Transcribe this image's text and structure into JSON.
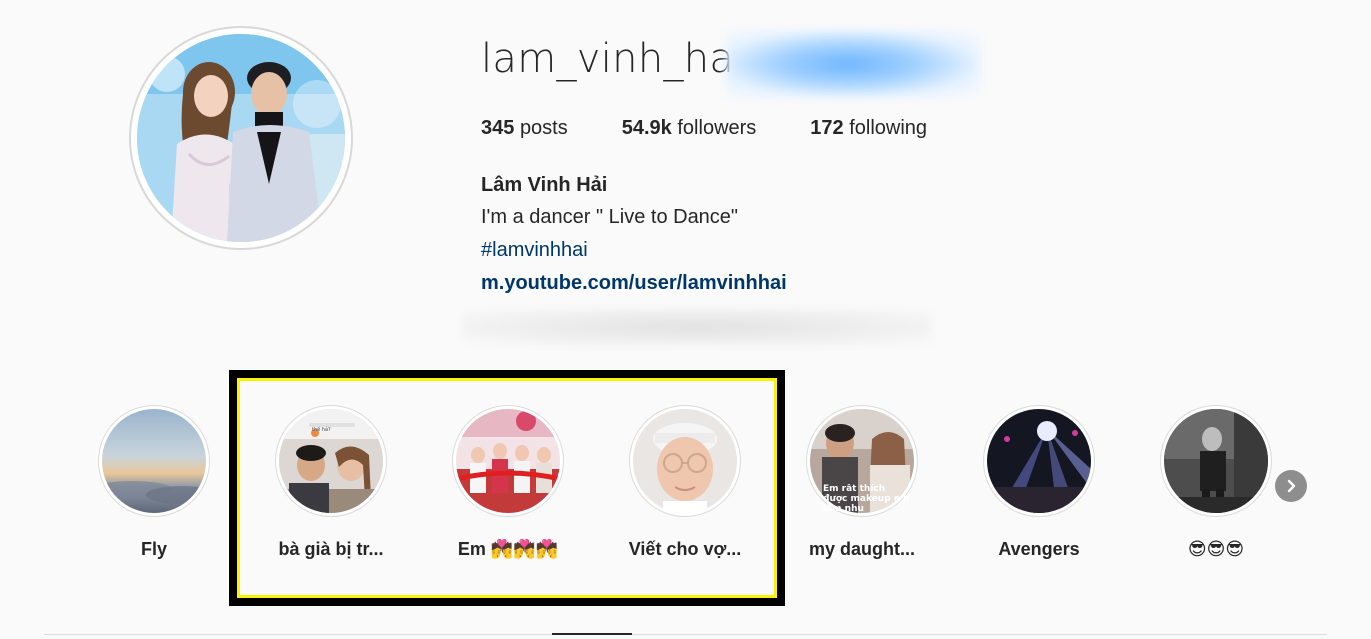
{
  "profile": {
    "username": "lam_vinh_hai",
    "stats": {
      "posts_count": "345",
      "posts_label": "posts",
      "followers_count": "54.9k",
      "followers_label": "followers",
      "following_count": "172",
      "following_label": "following"
    },
    "bio": {
      "name": "Lâm Vinh Hải",
      "text": "I'm a dancer \" Live to Dance\"",
      "hashtag": "#lamvinhhai",
      "link": "m.youtube.com/user/lamvinhhai"
    }
  },
  "highlights": [
    {
      "label": "Fly"
    },
    {
      "label": "bà già bị tr..."
    },
    {
      "label": "Em 💏💏💏"
    },
    {
      "label": "Viết cho vợ..."
    },
    {
      "label": "my daught..."
    },
    {
      "label": "Avengers"
    },
    {
      "label": "😎😎😎"
    }
  ],
  "highlight_thumb_texts": {
    "h2_tag": "thế hả?",
    "h5_caption_1": "Em rất thích",
    "h5_caption_2": "được makeup e h",
    "h5_caption_3": "lắm nhu"
  },
  "colors": {
    "link": "#00376b",
    "annotation_border": "#000000",
    "annotation_inner": "#fff200",
    "next_button": "#8e8e8e"
  },
  "icons": {
    "next": "chevron-right-icon"
  }
}
